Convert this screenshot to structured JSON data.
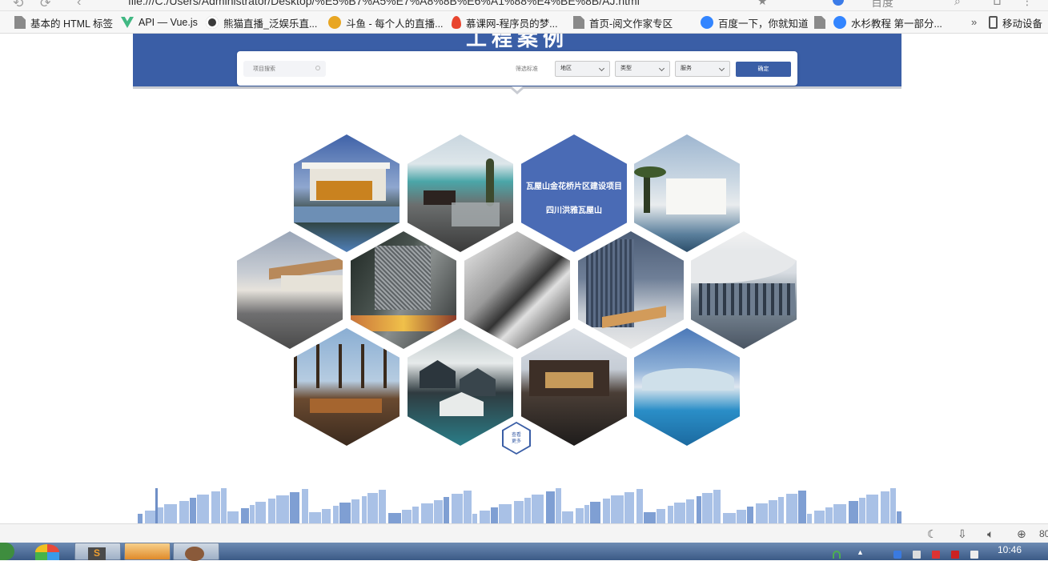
{
  "browser": {
    "url": "file:///C:/Users/Administrator/Desktop/%E5%B7%A5%E7%A8%8B%E6%A1%88%E4%BE%8B/AJ.html",
    "search_engine_label": "百度"
  },
  "bookmarks": [
    {
      "label": "基本的 HTML 标签",
      "icon": "page-icon"
    },
    {
      "label": "API — Vue.js",
      "icon": "vue-icon"
    },
    {
      "label": "熊猫直播_泛娱乐直...",
      "icon": "panda-icon"
    },
    {
      "label": "斗鱼 - 每个人的直播...",
      "icon": "fish-icon"
    },
    {
      "label": "慕课网-程序员的梦...",
      "icon": "fire-icon"
    },
    {
      "label": "首页-阅文作家专区",
      "icon": "page-icon"
    },
    {
      "label": "百度一下，你就知道",
      "icon": "paw-icon"
    },
    {
      "label": "",
      "icon": "page-icon"
    },
    {
      "label": "水杉教程 第一部分...",
      "icon": "paw-icon"
    },
    {
      "label": "移动设备",
      "icon": "mobile-icon"
    }
  ],
  "bookmarks_overflow": "»",
  "header": {
    "title": "工程案例"
  },
  "search": {
    "placeholder": "项目搜索",
    "filter_label": "筛选标准",
    "selects": [
      "地区",
      "类型",
      "服务"
    ],
    "confirm_label": "确定"
  },
  "gallery": {
    "featured": {
      "title": "瓦屋山金花桥片区建设项目",
      "subtitle": "四川洪雅瓦屋山"
    },
    "more_line1": "查看",
    "more_line2": "更多"
  },
  "statusbar": {
    "zoom": "80"
  },
  "taskbar": {
    "time": "10:46"
  },
  "colors": {
    "brand_blue": "#3a5ea6",
    "hex_blue": "#4a6bb5",
    "skyline": "#a9c1e6"
  }
}
